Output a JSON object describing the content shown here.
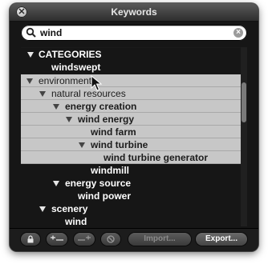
{
  "window": {
    "title": "Keywords",
    "close_label": "✕"
  },
  "search": {
    "value": "wind"
  },
  "outline": {
    "rows": [
      {
        "label": "CATEGORIES",
        "expanded": true
      },
      {
        "label": "windswept"
      },
      {
        "label": "environment",
        "expanded": true
      },
      {
        "label": "natural resources",
        "expanded": true
      },
      {
        "label": "energy creation",
        "expanded": true
      },
      {
        "label": "wind energy",
        "expanded": true
      },
      {
        "label": "wind farm"
      },
      {
        "label": "wind turbine",
        "expanded": true
      },
      {
        "label": "wind turbine generator"
      },
      {
        "label": "windmill"
      },
      {
        "label": "energy source",
        "expanded": true
      },
      {
        "label": "wind power"
      },
      {
        "label": "scenery",
        "expanded": true
      },
      {
        "label": "wind"
      }
    ]
  },
  "toolbar": {
    "import_label": "Import...",
    "export_label": "Export..."
  }
}
